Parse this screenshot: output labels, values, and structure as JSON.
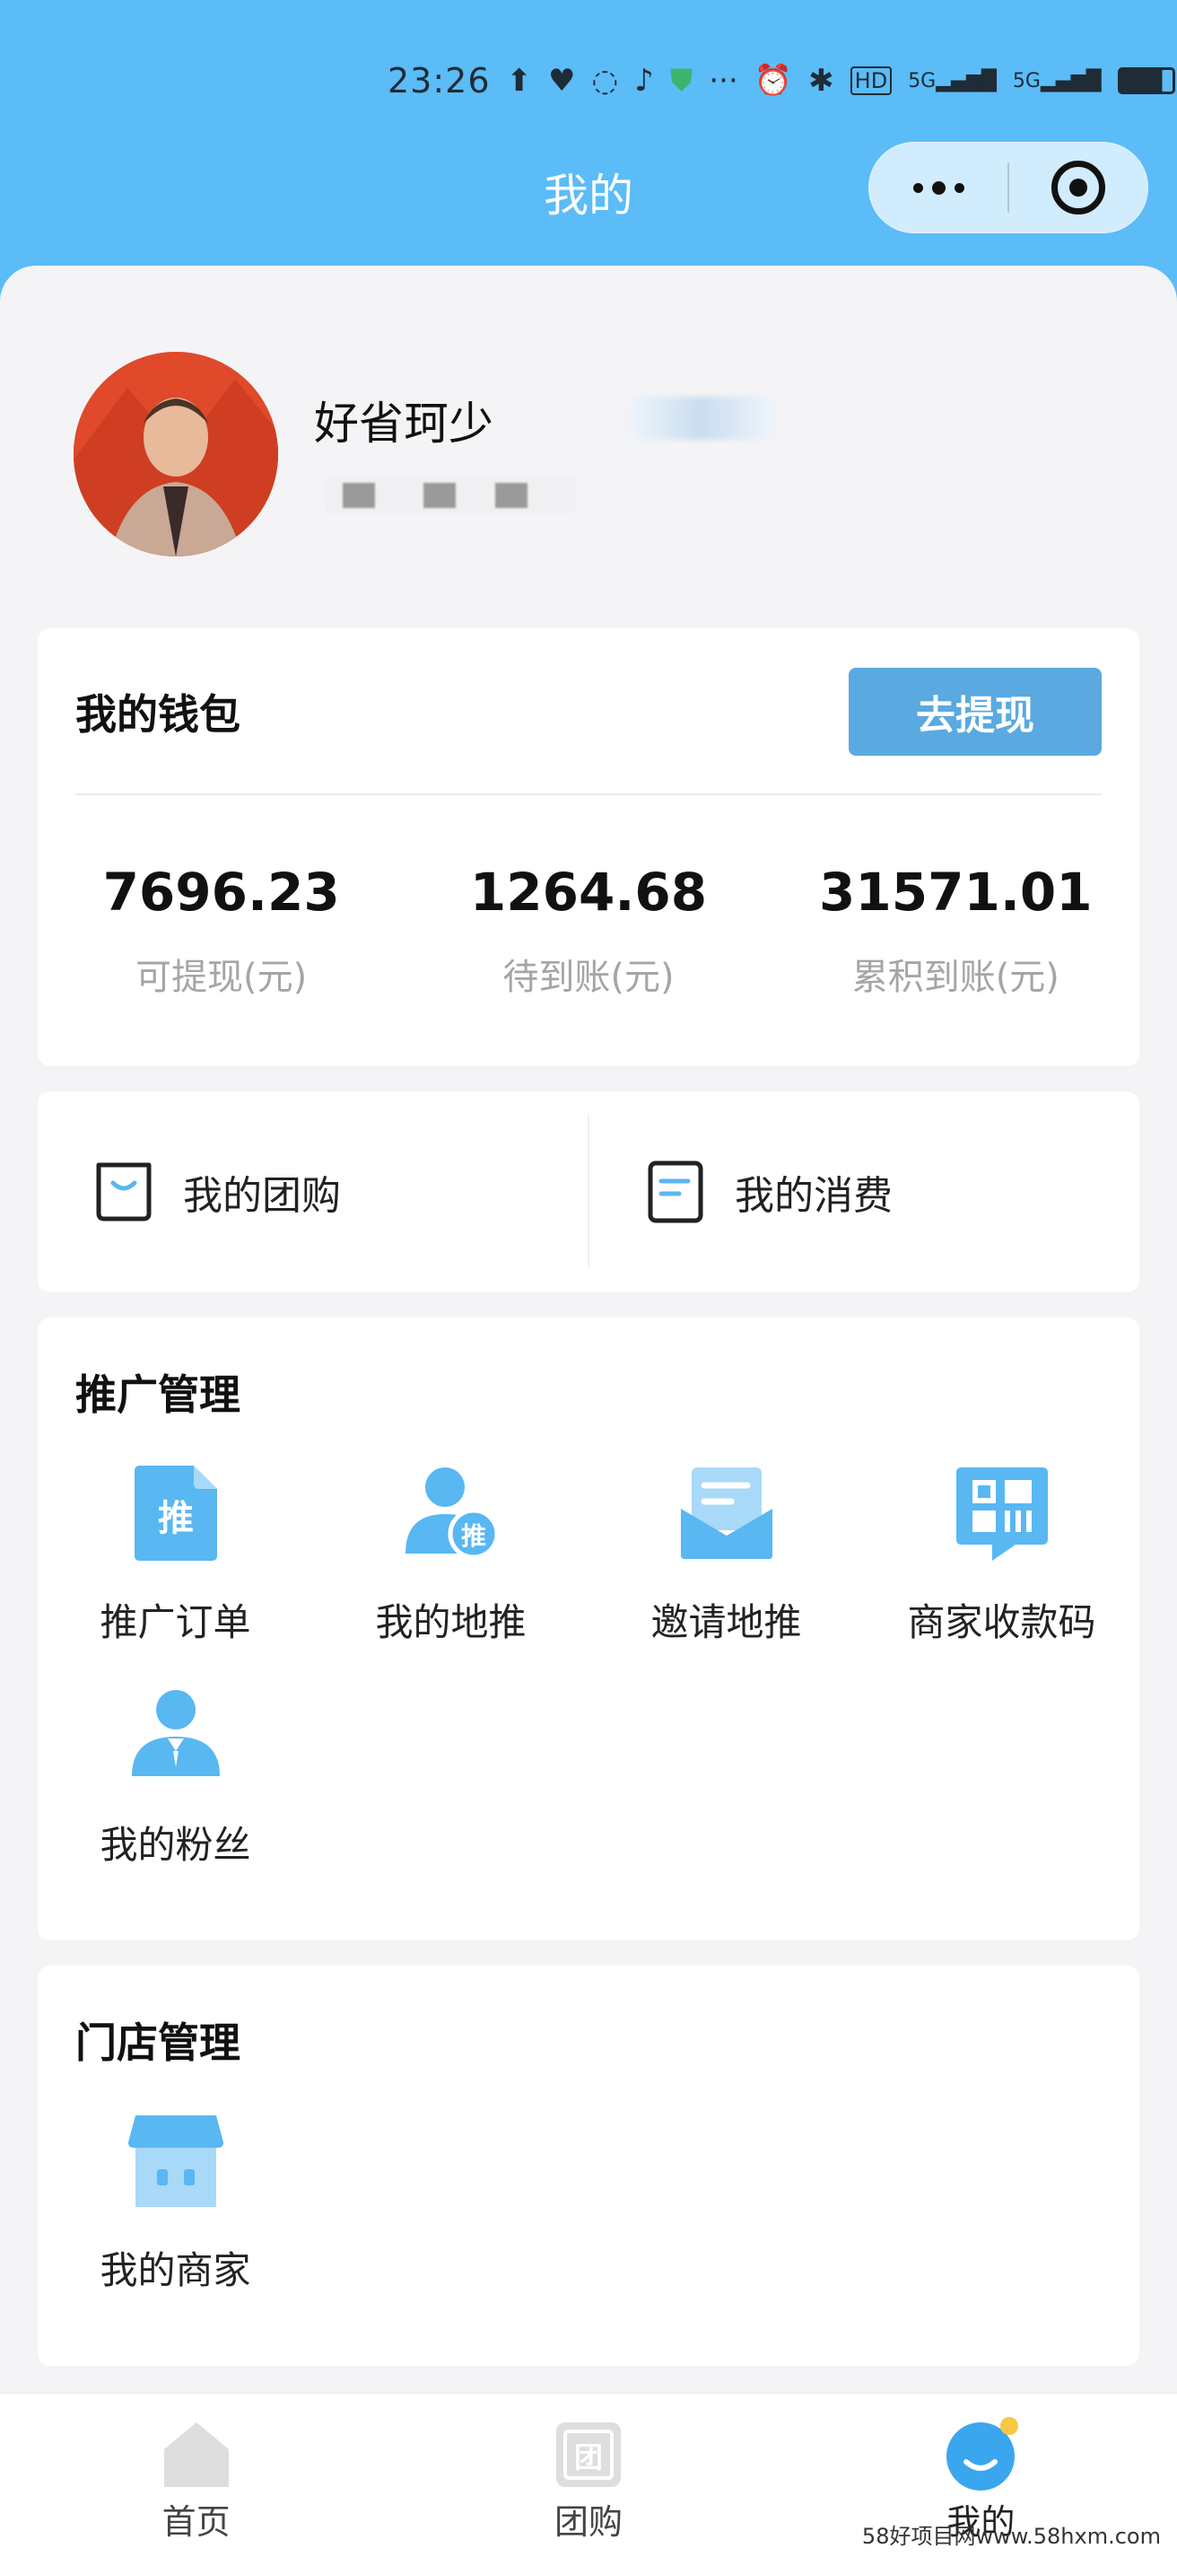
{
  "status_bar": {
    "time": "23:26",
    "icons": [
      "upload-icon",
      "heart-icon",
      "chat-icon",
      "tiktok-icon",
      "shield-icon",
      "more-dots",
      "alarm-icon",
      "bluetooth-icon",
      "hd-icon",
      "signal-5g-icon",
      "signal-5g-icon",
      "battery-icon"
    ],
    "more": "···",
    "hd": "HD",
    "sig1": "5G",
    "sig2": "5G"
  },
  "header": {
    "title": "我的",
    "capsule_icons": [
      "more-dots-icon",
      "close-target-icon"
    ]
  },
  "profile": {
    "nickname": "好省珂少"
  },
  "wallet": {
    "title": "我的钱包",
    "withdraw_label": "去提现",
    "stats": [
      {
        "value": "7696.23",
        "label": "可提现(元)"
      },
      {
        "value": "1264.68",
        "label": "待到账(元)"
      },
      {
        "value": "31571.01",
        "label": "累积到账(元)"
      }
    ]
  },
  "shortcuts": [
    {
      "label": "我的团购",
      "icon": "bag-icon"
    },
    {
      "label": "我的消费",
      "icon": "receipt-icon"
    }
  ],
  "promotion": {
    "title": "推广管理",
    "items": [
      {
        "label": "推广订单",
        "icon": "promo-order-icon",
        "glyph": "推"
      },
      {
        "label": "我的地推",
        "icon": "user-promo-icon",
        "glyph": "推"
      },
      {
        "label": "邀请地推",
        "icon": "envelope-icon"
      },
      {
        "label": "商家收款码",
        "icon": "qr-code-icon"
      },
      {
        "label": "我的粉丝",
        "icon": "fans-icon"
      }
    ]
  },
  "store": {
    "title": "门店管理",
    "items": [
      {
        "label": "我的商家",
        "icon": "shop-icon"
      }
    ]
  },
  "tabbar": {
    "items": [
      {
        "label": "首页",
        "icon": "home-icon",
        "active": false
      },
      {
        "label": "团购",
        "icon": "group-buy-icon",
        "glyph": "团",
        "active": false
      },
      {
        "label": "我的",
        "icon": "mine-icon",
        "active": true
      }
    ]
  },
  "watermark": "58好项目网www.58hxm.com",
  "colors": {
    "header_bg": "#5bbcf7",
    "accent": "#5aa9e0",
    "icon_blue": "#59b7f2"
  }
}
